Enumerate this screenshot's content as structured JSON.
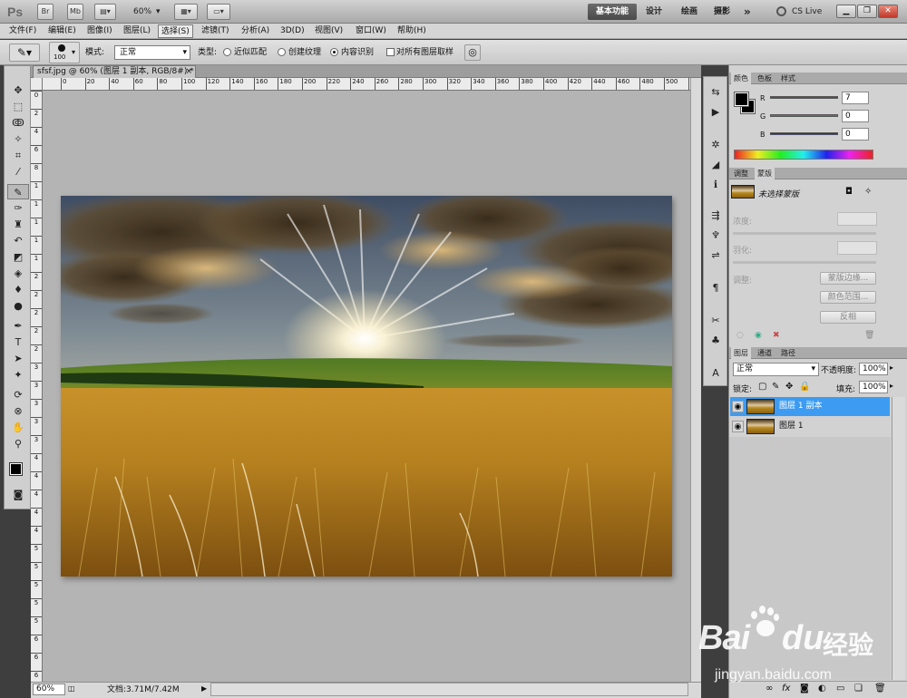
{
  "app": {
    "logo": "Ps"
  },
  "appbar": {
    "buttons": [
      "Br",
      "Mb"
    ],
    "zoom": "60%",
    "workspaces": [
      "基本功能",
      "设计",
      "绘画",
      "摄影"
    ],
    "more": "»",
    "cslive": "CS Live"
  },
  "menu": [
    "文件(F)",
    "编辑(E)",
    "图像(I)",
    "图层(L)",
    "选择(S)",
    "滤镜(T)",
    "分析(A)",
    "3D(D)",
    "视图(V)",
    "窗口(W)",
    "帮助(H)"
  ],
  "options": {
    "brush_size": "100",
    "mode_label": "模式:",
    "mode_value": "正常",
    "type_label": "类型:",
    "radio1": "近似匹配",
    "radio2": "创建纹理",
    "radio3": "内容识别",
    "checkbox": "对所有图层取样"
  },
  "document": {
    "tab_title": "sfsf.jpg @ 60% (图层 1 副本, RGB/8#) *",
    "ruler_h": [
      "0",
      "20",
      "40",
      "60",
      "80",
      "100",
      "120",
      "140",
      "160",
      "180",
      "200",
      "220",
      "240",
      "260",
      "280",
      "300",
      "320",
      "340",
      "360",
      "380",
      "400",
      "420",
      "440",
      "460",
      "480",
      "500",
      "5"
    ],
    "ruler_v": [
      "0",
      "2",
      "4",
      "6",
      "8",
      "1",
      "1",
      "1",
      "1",
      "1",
      "2",
      "2",
      "2",
      "2",
      "2",
      "3",
      "3",
      "3",
      "3",
      "3",
      "4",
      "4",
      "4",
      "4",
      "4",
      "5",
      "5",
      "5",
      "5",
      "5",
      "6",
      "6",
      "6"
    ]
  },
  "status": {
    "zoom": "60%",
    "doc": "文档:3.71M/7.42M"
  },
  "color_panel": {
    "tabs": [
      "颜色",
      "色板",
      "样式"
    ],
    "r_label": "R",
    "r_value": "7",
    "g_label": "G",
    "g_value": "0",
    "b_label": "B",
    "b_value": "0"
  },
  "masks_panel": {
    "tabs": [
      "调整",
      "蒙版"
    ],
    "no_selection": "未选择蒙版",
    "density": "浓度:",
    "feather": "羽化:",
    "refine": "调整:",
    "btn_edge": "蒙版边缘...",
    "btn_range": "颜色范围...",
    "btn_invert": "反相"
  },
  "layers_panel": {
    "tabs": [
      "图层",
      "通道",
      "路径"
    ],
    "blend": "正常",
    "opacity_label": "不透明度:",
    "opacity_value": "100%",
    "lock_label": "锁定:",
    "fill_label": "填充:",
    "fill_value": "100%",
    "layers": [
      {
        "name": "图层 1 副本",
        "selected": true
      },
      {
        "name": "图层 1",
        "selected": false
      }
    ]
  },
  "watermark": {
    "brand": "Bai",
    "brand2": "du",
    "cn": "经验",
    "url": "jingyan.baidu.com"
  },
  "colors": {
    "selected_layer": "#3d9cf2",
    "slider_r": "#d21a1a",
    "slider_g": "#1aa51a",
    "slider_b": "#1a2dcf"
  }
}
